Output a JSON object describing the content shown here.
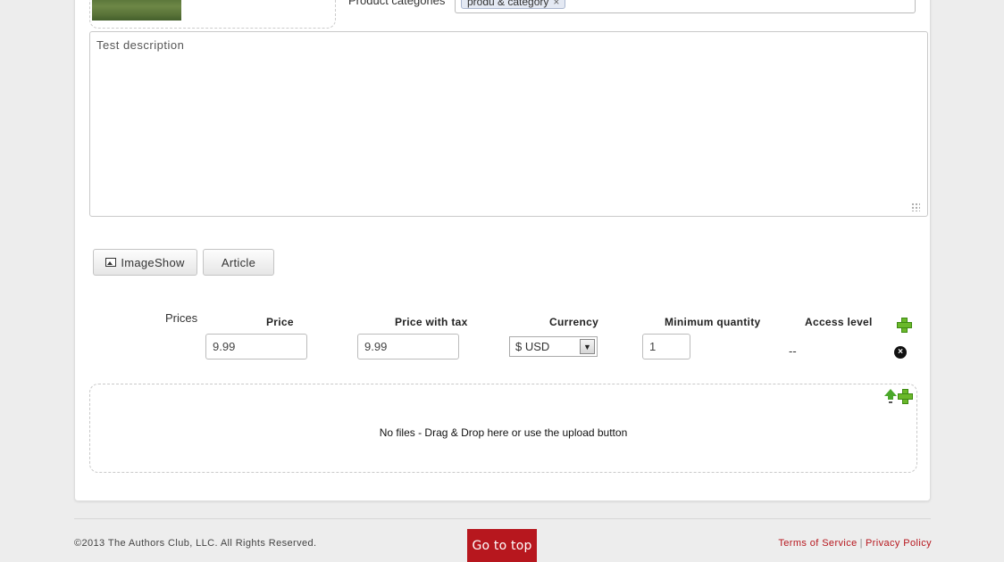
{
  "top": {
    "categories_label": "Product categories",
    "category_chip": "produ & category",
    "chip_remove": "×"
  },
  "description": {
    "value": "Test description"
  },
  "buttons": {
    "imageshow": "ImageShow",
    "article": "Article"
  },
  "prices": {
    "section_label": "Prices",
    "columns": {
      "price": "Price",
      "price_with_tax": "Price with tax",
      "currency": "Currency",
      "minimum_quantity": "Minimum quantity",
      "access_level": "Access level"
    },
    "row": {
      "price": "9.99",
      "price_with_tax": "9.99",
      "currency": "$ USD",
      "minimum_quantity": "1",
      "access_level": "--"
    }
  },
  "files": {
    "empty_text": "No files - Drag & Drop here or use the upload button"
  },
  "footer": {
    "copyright": "©2013 The Authors Club, LLC. All Rights Reserved.",
    "go_top": "Go to top",
    "terms": "Terms of Service",
    "separator": "|",
    "privacy": "Privacy Policy"
  },
  "icons": {
    "add": "plus-icon",
    "remove": "remove-icon",
    "upload": "upload-icon",
    "image": "image-icon"
  },
  "colors": {
    "accent_red": "#b7171e",
    "add_green": "#6ab82a"
  }
}
